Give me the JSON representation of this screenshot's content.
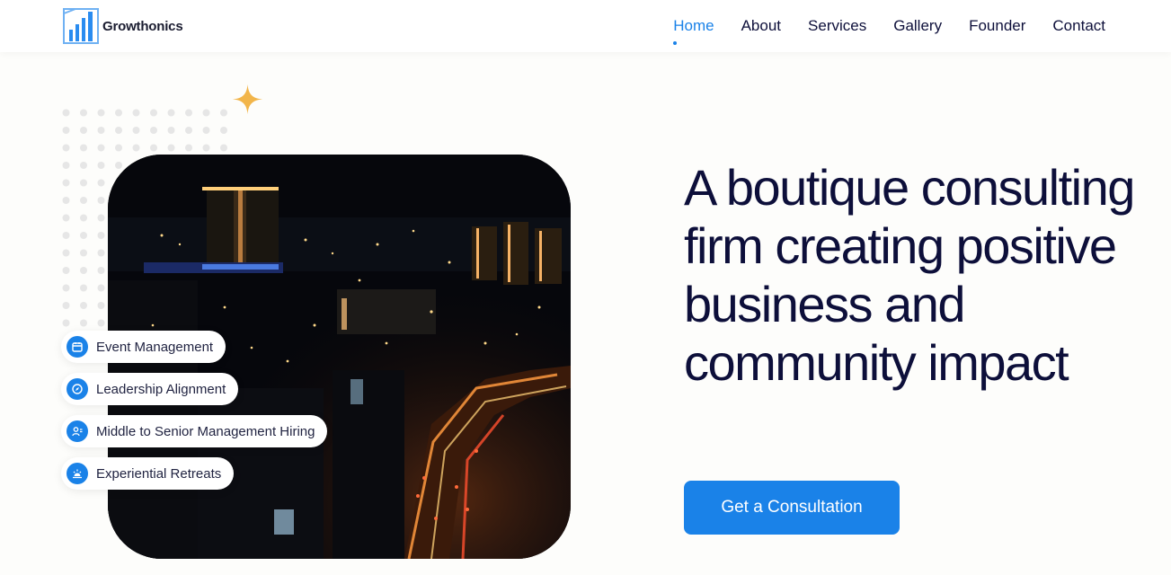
{
  "brand": {
    "name": "Growthonics",
    "logo_icon": "bar-chart-icon",
    "accent": "#1a82e8",
    "text": "#0d0f3a"
  },
  "nav": {
    "items": [
      {
        "label": "Home",
        "active": true
      },
      {
        "label": "About",
        "active": false
      },
      {
        "label": "Services",
        "active": false
      },
      {
        "label": "Gallery",
        "active": false
      },
      {
        "label": "Founder",
        "active": false
      },
      {
        "label": "Contact",
        "active": false
      }
    ]
  },
  "hero": {
    "headline": "A boutique consulting firm creating positive business and community impact",
    "cta_label": "Get a Consultation",
    "image_subject": "night-city-aerial",
    "services": [
      {
        "label": "Event Management",
        "icon": "calendar-icon"
      },
      {
        "label": "Leadership Alignment",
        "icon": "compass-icon"
      },
      {
        "label": "Middle to Senior Management Hiring",
        "icon": "user-badge-icon"
      },
      {
        "label": "Experiential Retreats",
        "icon": "sunrise-icon"
      }
    ]
  }
}
